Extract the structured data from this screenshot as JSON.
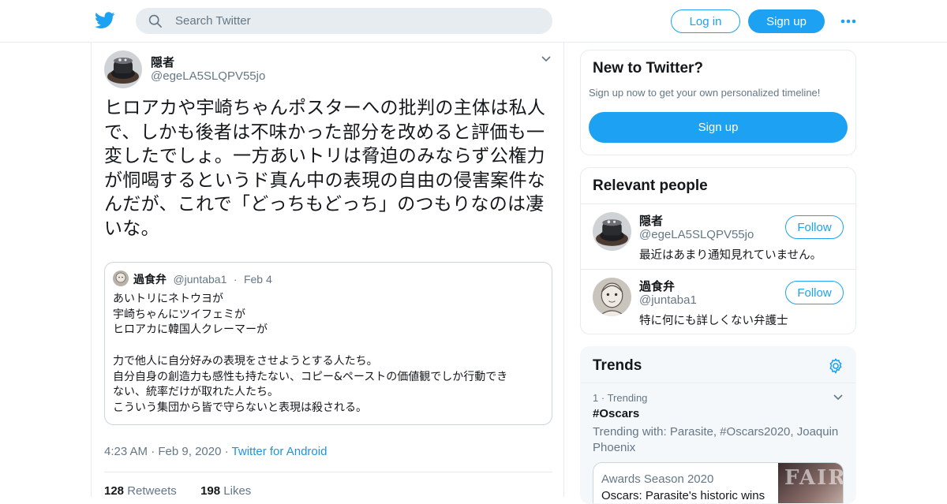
{
  "header": {
    "search_placeholder": "Search Twitter",
    "login_label": "Log in",
    "signup_label": "Sign up"
  },
  "tweet": {
    "author_name": "隠者",
    "author_handle": "@egeLA5SLQPV55jo",
    "text": "ヒロアカや宇崎ちゃんポスターへの批判の主体は私人で、しかも後者は不味かった部分を改めると評価も一変したでしょ。一方あいトリは脅迫のみならず公権力が恫喝するというド真ん中の表現の自由の侵害案件なんだが、これで「どっちもどっち」のつもりなのは凄いな。",
    "time": "4:23 AM",
    "date": "Feb 9, 2020",
    "source": "Twitter for Android",
    "retweets_count": "128",
    "retweets_label": "Retweets",
    "likes_count": "198",
    "likes_label": "Likes"
  },
  "quote": {
    "author_name": "過食弁",
    "author_handle": "@juntaba1",
    "date": "Feb 4",
    "lines": [
      "あいトリにネトウヨが",
      "宇崎ちゃんにツイフェミが",
      "ヒロアカに韓国人クレーマーが",
      "",
      "力で他人に自分好みの表現をさせようとする人たち。",
      "自分自身の創造力も感性も持たない、コピー&ペーストの価値観でしか行動でき",
      "ない、統率だけが取れた人たち。",
      "こういう集団から皆で守らないと表現は殺される。"
    ]
  },
  "sidebar": {
    "new_to_twitter": {
      "title": "New to Twitter?",
      "subtitle": "Sign up now to get your own personalized timeline!",
      "signup_label": "Sign up"
    },
    "relevant_people": {
      "title": "Relevant people",
      "people": [
        {
          "name": "隠者",
          "handle": "@egeLA5SLQPV55jo",
          "bio": "最近はあまり通知見れていません。",
          "follow_label": "Follow"
        },
        {
          "name": "過食弁",
          "handle": "@juntaba1",
          "bio": "特に何にも詳しくない弁護士",
          "follow_label": "Follow"
        }
      ]
    },
    "trends": {
      "title": "Trends",
      "items": [
        {
          "rank": "1",
          "category": "Trending",
          "name": "#Oscars",
          "trending_with": "Trending with: Parasite, #Oscars2020, Joaquin Phoenix",
          "news": {
            "kicker": "Awards Season 2020",
            "headline": "Oscars: Parasite's historic wins",
            "thumb_text": "FAIR"
          }
        }
      ]
    }
  },
  "colors": {
    "accent": "#1da1f2",
    "text": "#14171a",
    "secondary_text": "#657786",
    "border": "#e6ecf0"
  },
  "icons": [
    "twitter-bird-icon",
    "search-icon",
    "more-icon",
    "caret-down-icon",
    "gear-icon",
    "chevron-down-icon"
  ]
}
